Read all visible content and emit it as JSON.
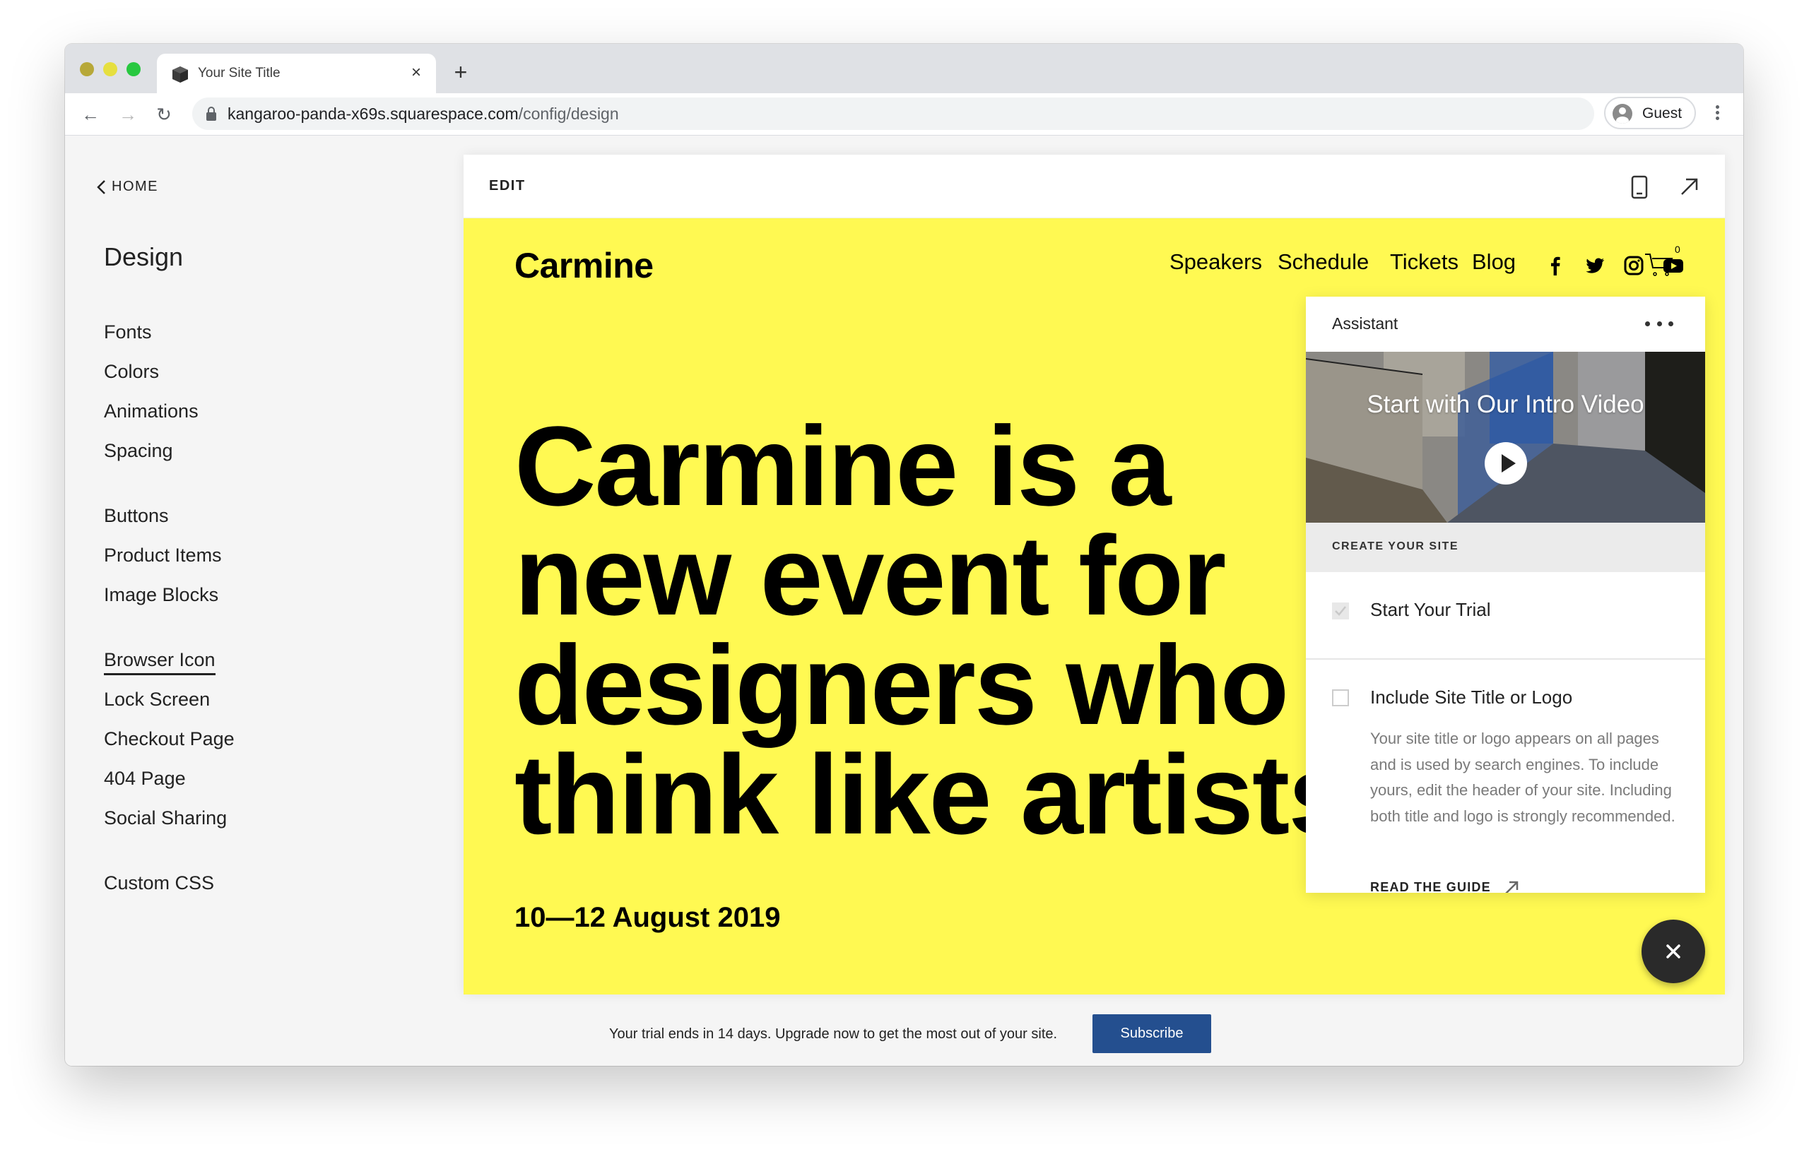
{
  "browser": {
    "tab_title": "Your Site Title",
    "tab_favicon": "cube-icon",
    "url_host": "kangaroo-panda-x69s.squarespace.com",
    "url_path": "/config/design",
    "profile_label": "Guest",
    "traffic_light_colors": [
      "#b7a838",
      "#e6df3f",
      "#28c840"
    ]
  },
  "sidebar": {
    "back_label": "HOME",
    "title": "Design",
    "groups": [
      [
        "Fonts",
        "Colors",
        "Animations",
        "Spacing"
      ],
      [
        "Buttons",
        "Product Items",
        "Image Blocks"
      ],
      [
        "Browser Icon",
        "Lock Screen",
        "Checkout Page",
        "404 Page",
        "Social Sharing"
      ],
      [
        "Custom CSS"
      ]
    ],
    "active_item": "Browser Icon"
  },
  "preview": {
    "mode_label": "EDIT",
    "icons": [
      "mobile-view-icon",
      "open-external-icon"
    ]
  },
  "site": {
    "logo": "Carmine",
    "nav": [
      "Speakers",
      "Schedule",
      "Tickets",
      "Blog"
    ],
    "social_icons": [
      "facebook-icon",
      "twitter-icon",
      "instagram-icon",
      "youtube-icon"
    ],
    "cart_count": "0",
    "headline_lines": [
      "Carmine is a",
      "new event for",
      "designers who",
      "think like artists"
    ],
    "date": "10—12 August 2019",
    "background_color": "#fff952"
  },
  "assistant": {
    "title": "Assistant",
    "video_title": "Start with Our Intro Video",
    "section_label": "CREATE YOUR SITE",
    "tasks": [
      {
        "title": "Start Your Trial",
        "done": true
      },
      {
        "title": "Include Site Title or Logo",
        "done": false,
        "description": "Your site title or logo appears on all pages and is used by search engines. To include yours, edit the header of your site. Including both title and logo is strongly recommended.",
        "link_label": "READ THE GUIDE"
      }
    ]
  },
  "trial_banner": {
    "text": "Your trial ends in 14 days. Upgrade now to get the most out of your site.",
    "button_label": "Subscribe",
    "button_color": "#244f8f"
  }
}
